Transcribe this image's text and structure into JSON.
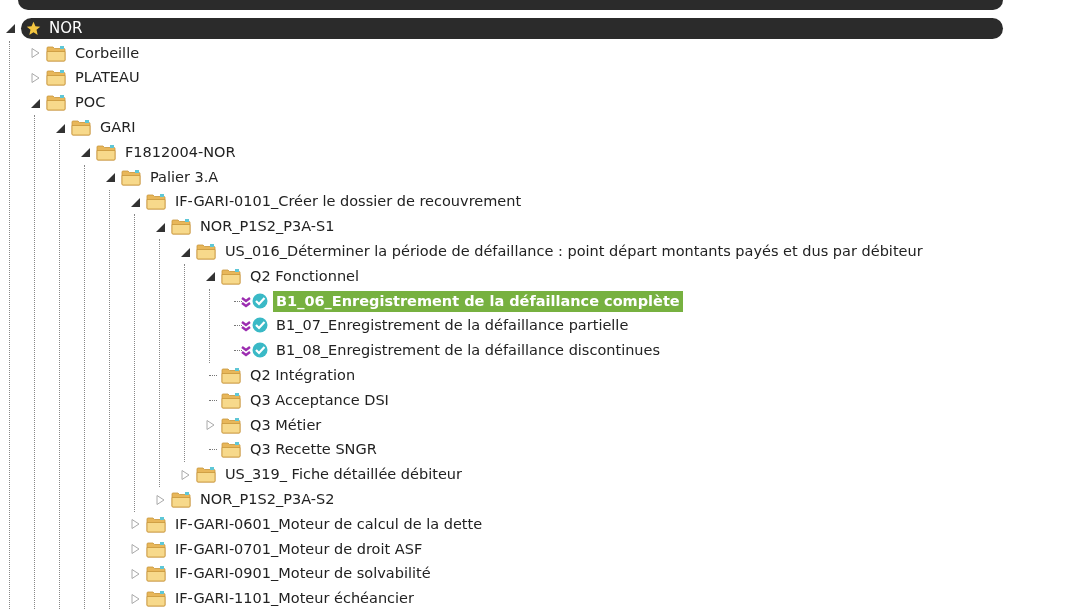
{
  "tree": {
    "label": "NOR",
    "kind": "project",
    "expanded": true,
    "selected": false,
    "children": [
      {
        "label": "Corbeille",
        "kind": "folder",
        "expanded": false,
        "selected": false
      },
      {
        "label": "PLATEAU",
        "kind": "folder",
        "expanded": false,
        "selected": false
      },
      {
        "label": "POC",
        "kind": "folder",
        "expanded": true,
        "selected": false,
        "children": [
          {
            "label": "GARI",
            "kind": "folder",
            "expanded": true,
            "selected": false,
            "children": [
              {
                "label": "F1812004-NOR",
                "kind": "folder",
                "expanded": true,
                "selected": false,
                "children": [
                  {
                    "label": "Palier 3.A",
                    "kind": "folder",
                    "expanded": true,
                    "selected": false,
                    "children": [
                      {
                        "label": "IF-GARI-0101_Créer le dossier de recouvrement",
                        "kind": "folder",
                        "expanded": true,
                        "selected": false,
                        "children": [
                          {
                            "label": "NOR_P1S2_P3A-S1",
                            "kind": "folder",
                            "expanded": true,
                            "selected": false,
                            "children": [
                              {
                                "label": "US_016_Déterminer la période de défaillance : point départ montants payés et dus par débiteur",
                                "kind": "folder",
                                "expanded": true,
                                "selected": false,
                                "children": [
                                  {
                                    "label": "Q2 Fonctionnel",
                                    "kind": "folder",
                                    "expanded": true,
                                    "selected": false,
                                    "children": [
                                      {
                                        "label": "B1_06_Enregistrement de la défaillance complète",
                                        "kind": "test",
                                        "selected": true
                                      },
                                      {
                                        "label": "B1_07_Enregistrement de la défaillance partielle",
                                        "kind": "test",
                                        "selected": false
                                      },
                                      {
                                        "label": "B1_08_Enregistrement de la défaillance discontinues",
                                        "kind": "test",
                                        "selected": false
                                      }
                                    ]
                                  },
                                  {
                                    "label": "Q2 Intégration",
                                    "kind": "folder",
                                    "selected": false
                                  },
                                  {
                                    "label": "Q3 Acceptance DSI",
                                    "kind": "folder",
                                    "selected": false
                                  },
                                  {
                                    "label": "Q3 Métier",
                                    "kind": "folder",
                                    "expanded": false,
                                    "selected": false
                                  },
                                  {
                                    "label": "Q3 Recette SNGR",
                                    "kind": "folder",
                                    "selected": false
                                  }
                                ]
                              },
                              {
                                "label": "US_319_ Fiche détaillée débiteur",
                                "kind": "folder",
                                "expanded": false,
                                "selected": false
                              }
                            ]
                          },
                          {
                            "label": "NOR_P1S2_P3A-S2",
                            "kind": "folder",
                            "expanded": false,
                            "selected": false
                          }
                        ]
                      },
                      {
                        "label": "IF-GARI-0601_Moteur de calcul de la dette",
                        "kind": "folder",
                        "expanded": false,
                        "selected": false
                      },
                      {
                        "label": "IF-GARI-0701_Moteur de droit ASF",
                        "kind": "folder",
                        "expanded": false,
                        "selected": false
                      },
                      {
                        "label": "IF-GARI-0901_Moteur de solvabilité",
                        "kind": "folder",
                        "expanded": false,
                        "selected": false
                      },
                      {
                        "label": "IF-GARI-1101_Moteur échéancier",
                        "kind": "folder",
                        "expanded": false,
                        "selected": false
                      }
                    ]
                  }
                ]
              }
            ]
          }
        ]
      }
    ]
  }
}
